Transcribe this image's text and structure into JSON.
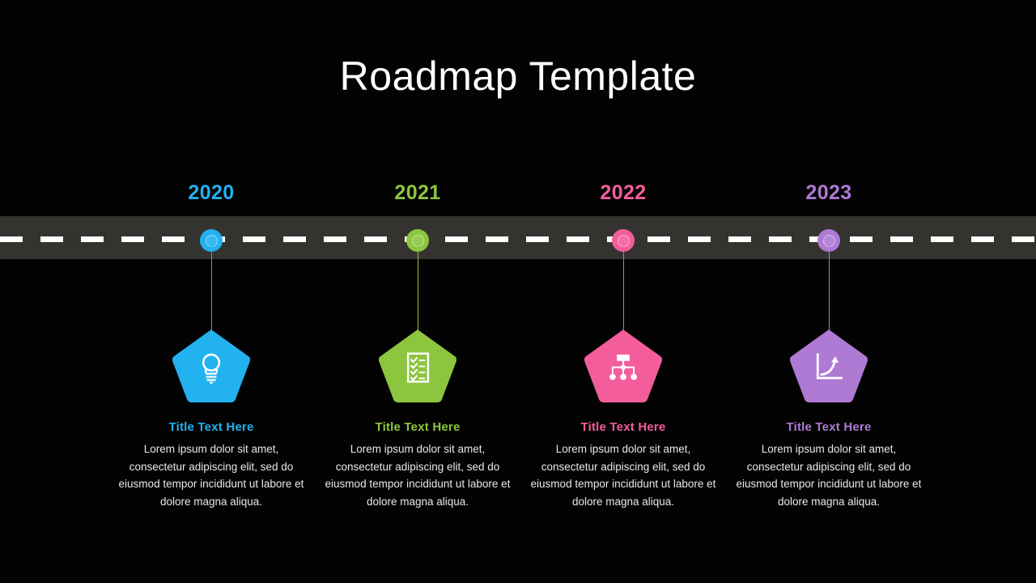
{
  "page": {
    "title": "Roadmap Template",
    "background_color": "#030303",
    "road_color": "#35332f",
    "dash_color": "#ffffff"
  },
  "milestones": [
    {
      "year": "2020",
      "color": "#22b2f0",
      "icon": "lightbulb-icon",
      "title": "Title Text Here",
      "body": "Lorem ipsum dolor sit amet, consectetur adipiscing elit, sed do eiusmod tempor incididunt ut labore et dolore magna aliqua."
    },
    {
      "year": "2021",
      "color": "#8cc63e",
      "icon": "checklist-icon",
      "title": "Title Text Here",
      "body": "Lorem ipsum dolor sit amet, consectetur adipiscing elit, sed do eiusmod tempor incididunt ut labore et dolore magna aliqua."
    },
    {
      "year": "2022",
      "color": "#f45d9b",
      "icon": "hierarchy-icon",
      "title": "Title Text Here",
      "body": "Lorem ipsum dolor sit amet, consectetur adipiscing elit, sed do eiusmod tempor incididunt ut labore et dolore magna aliqua."
    },
    {
      "year": "2023",
      "color": "#ae7ad4",
      "icon": "growth-chart-icon",
      "title": "Title Text Here",
      "body": "Lorem ipsum dolor sit amet, consectetur adipiscing elit, sed do eiusmod tempor incididunt ut labore et dolore magna aliqua."
    }
  ]
}
